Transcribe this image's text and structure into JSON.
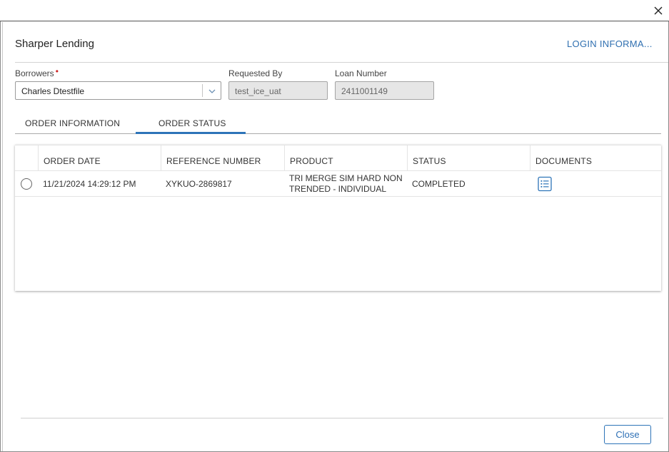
{
  "dialog": {
    "title": "Sharper Lending",
    "login_link": "LOGIN INFORMA..."
  },
  "fields": {
    "borrowers": {
      "label": "Borrowers",
      "required_mark": "•",
      "value": "Charles Dtestfile"
    },
    "requested_by": {
      "label": "Requested By",
      "value": "test_ice_uat"
    },
    "loan_number": {
      "label": "Loan Number",
      "value": "2411001149"
    }
  },
  "tabs": [
    {
      "label": "ORDER INFORMATION",
      "active": false
    },
    {
      "label": "ORDER STATUS",
      "active": true
    }
  ],
  "table": {
    "columns": [
      "ORDER DATE",
      "REFERENCE NUMBER",
      "PRODUCT",
      "STATUS",
      "DOCUMENTS"
    ],
    "rows": [
      {
        "order_date": "11/21/2024 14:29:12 PM",
        "reference_number": "XYKUO-2869817",
        "product_line1": "TRI MERGE SIM HARD NON",
        "product_line2": "TRENDED - INDIVIDUAL",
        "status": "COMPLETED",
        "documents_icon": "document-list-icon"
      }
    ]
  },
  "footer": {
    "close_label": "Close"
  },
  "colors": {
    "accent": "#2d74b8",
    "required": "#cc2222",
    "readonly_bg": "#e6e6e6"
  },
  "icons": {
    "window_close": "close-icon",
    "dropdown": "chevron-down-icon",
    "row_select": "radio-icon",
    "documents": "document-list-icon"
  }
}
